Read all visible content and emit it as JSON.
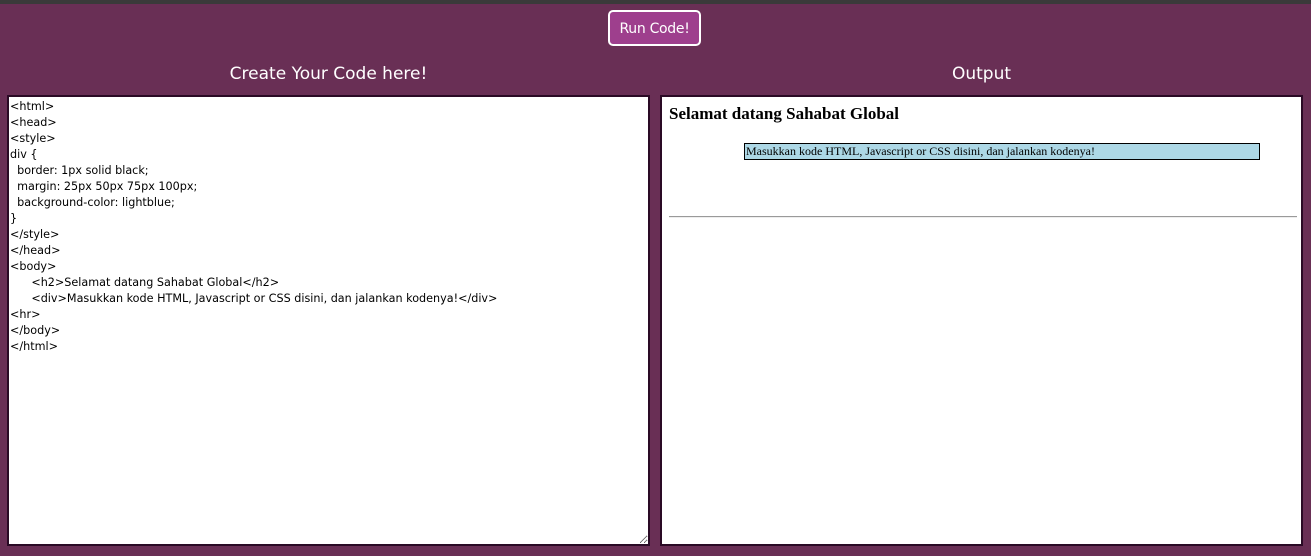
{
  "toolbar": {
    "run_label": "Run Code!"
  },
  "editor_panel": {
    "title": "Create Your Code here!",
    "code": "<html>\n<head>\n<style>\ndiv {\n  border: 1px solid black;\n  margin: 25px 50px 75px 100px;\n  background-color: lightblue;\n}\n</style>\n</head>\n<body>\n      <h2>Selamat datang Sahabat Global</h2>\n      <div>Masukkan kode HTML, Javascript or CSS disini, dan jalankan kodenya!</div>\n<hr>\n</body>\n</html>"
  },
  "output_panel": {
    "title": "Output",
    "heading": "Selamat datang Sahabat Global",
    "div_text": "Masukkan kode HTML, Javascript or CSS disini, dan jalankan kodenya!"
  },
  "colors": {
    "background": "#692f55",
    "button": "#9e3f8d",
    "output_div_background": "#add8e6"
  }
}
